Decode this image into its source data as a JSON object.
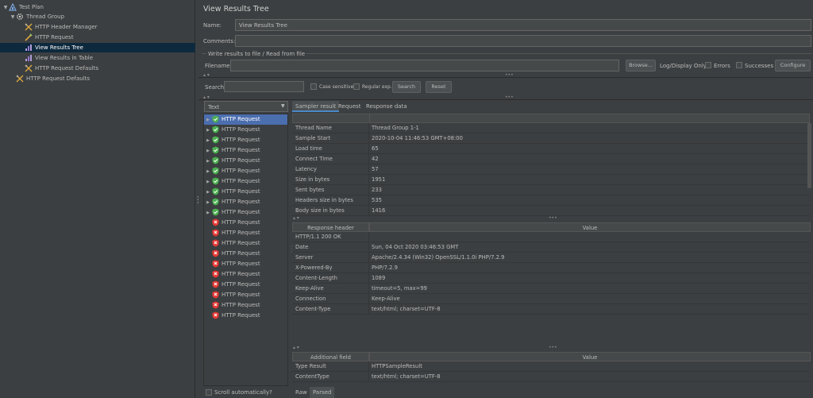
{
  "tree": {
    "items": [
      {
        "label": "Test Plan",
        "icon": "test-plan-icon",
        "toggle": "▼"
      },
      {
        "label": "Thread Group",
        "icon": "gear-icon",
        "toggle": "▼"
      },
      {
        "label": "HTTP Header Manager",
        "icon": "wrench-icon",
        "toggle": ""
      },
      {
        "label": "HTTP Request",
        "icon": "pencil-icon",
        "toggle": ""
      },
      {
        "label": "View Results Tree",
        "icon": "chart-icon",
        "toggle": ""
      },
      {
        "label": "View Results in Table",
        "icon": "chart-icon",
        "toggle": ""
      },
      {
        "label": "HTTP Request Defaults",
        "icon": "wrench-icon",
        "toggle": ""
      },
      {
        "label": "HTTP Request Defaults",
        "icon": "wrench-icon",
        "toggle": ""
      }
    ]
  },
  "panel": {
    "title": "View Results Tree",
    "name_label": "Name:",
    "name_value": "View Results Tree",
    "comments_label": "Comments:",
    "comments_value": "",
    "file_section": "Write results to file / Read from file",
    "filename_label": "Filename",
    "filename_value": "",
    "browse": "Browse...",
    "logdisplay": "Log/Display Only:",
    "errors": "Errors",
    "successes": "Successes",
    "configure": "Configure"
  },
  "search": {
    "label": "Search:",
    "value": "",
    "case_sensitive": "Case sensitive",
    "regex": "Regular exp.",
    "search_btn": "Search",
    "reset_btn": "Reset"
  },
  "renderer": {
    "selected": "Text"
  },
  "results": {
    "items": [
      {
        "label": "HTTP Request",
        "status": "success"
      },
      {
        "label": "HTTP Request",
        "status": "success"
      },
      {
        "label": "HTTP Request",
        "status": "success"
      },
      {
        "label": "HTTP Request",
        "status": "success"
      },
      {
        "label": "HTTP Request",
        "status": "success"
      },
      {
        "label": "HTTP Request",
        "status": "success"
      },
      {
        "label": "HTTP Request",
        "status": "success"
      },
      {
        "label": "HTTP Request",
        "status": "success"
      },
      {
        "label": "HTTP Request",
        "status": "success"
      },
      {
        "label": "HTTP Request",
        "status": "success"
      },
      {
        "label": "HTTP Request",
        "status": "error"
      },
      {
        "label": "HTTP Request",
        "status": "error"
      },
      {
        "label": "HTTP Request",
        "status": "error"
      },
      {
        "label": "HTTP Request",
        "status": "error"
      },
      {
        "label": "HTTP Request",
        "status": "error"
      },
      {
        "label": "HTTP Request",
        "status": "error"
      },
      {
        "label": "HTTP Request",
        "status": "error"
      },
      {
        "label": "HTTP Request",
        "status": "error"
      },
      {
        "label": "HTTP Request",
        "status": "error"
      },
      {
        "label": "HTTP Request",
        "status": "error"
      }
    ],
    "scroll_auto": "Scroll automatically?"
  },
  "tabs": [
    "Sampler result",
    "Request",
    "Response data"
  ],
  "sampler_rows": [
    [
      "Thread Name",
      "Thread Group 1-1"
    ],
    [
      "Sample Start",
      "2020-10-04 11:46:53 GMT+08:00"
    ],
    [
      "Load time",
      "65"
    ],
    [
      "Connect Time",
      "42"
    ],
    [
      "Latency",
      "57"
    ],
    [
      "Size in bytes",
      "1951"
    ],
    [
      "Sent bytes",
      "233"
    ],
    [
      "Headers size in bytes",
      "535"
    ],
    [
      "Body size in bytes",
      "1416"
    ]
  ],
  "response_header": {
    "col1": "Response header",
    "col2": "Value",
    "rows": [
      [
        "HTTP/1.1 200 OK",
        ""
      ],
      [
        "Date",
        "Sun, 04 Oct 2020 03:46:53 GMT"
      ],
      [
        "Server",
        "Apache/2.4.34 (Win32) OpenSSL/1.1.0i PHP/7.2.9"
      ],
      [
        "X-Powered-By",
        "PHP/7.2.9"
      ],
      [
        "Content-Length",
        "1089"
      ],
      [
        "Keep-Alive",
        "timeout=5, max=99"
      ],
      [
        "Connection",
        "Keep-Alive"
      ],
      [
        "Content-Type",
        "text/html; charset=UTF-8"
      ]
    ]
  },
  "additional": {
    "col1": "Additional field",
    "col2": "Value",
    "rows": [
      [
        "Type Result",
        "HTTPSampleResult"
      ],
      [
        "ContentType",
        "text/html; charset=UTF-8"
      ]
    ]
  },
  "bottom_tabs": [
    "Raw",
    "Parsed"
  ],
  "colors": {
    "success": "#4caf50",
    "error": "#e53935",
    "accent": "#4b6eaf"
  }
}
